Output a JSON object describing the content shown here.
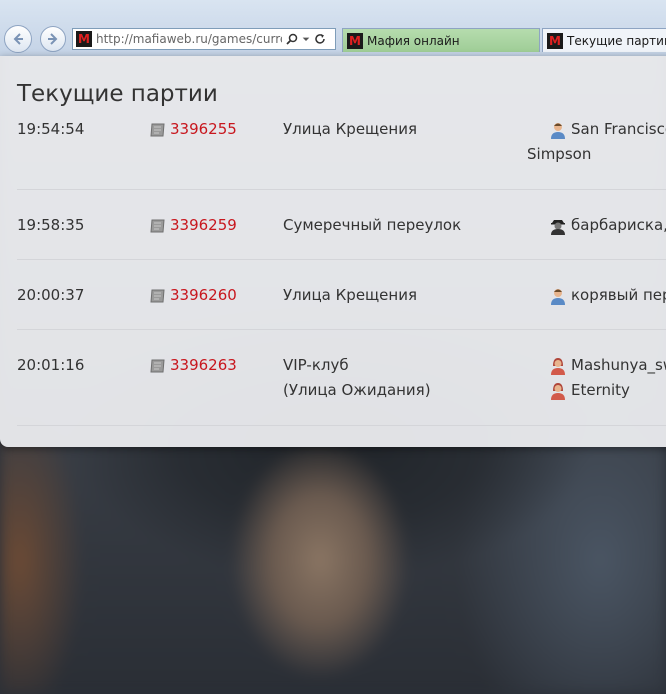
{
  "browser": {
    "address_url": "http://mafiaweb.ru/games/current/",
    "tabs": [
      {
        "title": "Мафия онлайн"
      },
      {
        "title": "Текущие партии ::"
      }
    ]
  },
  "page": {
    "title": "Текущие партии"
  },
  "games": [
    {
      "time": "19:54:54",
      "game_id": "3396255",
      "location": [
        "Улица Крещения"
      ],
      "players": [
        {
          "name": "San Francisco",
          "icon": "male-user-icon"
        },
        {
          "name": "Simpson",
          "icon": ""
        }
      ]
    },
    {
      "time": "19:58:35",
      "game_id": "3396259",
      "location": [
        "Сумеречный переулок"
      ],
      "players": [
        {
          "name": "барбариска,",
          "icon": "spy-user-icon"
        }
      ]
    },
    {
      "time": "20:00:37",
      "game_id": "3396260",
      "location": [
        "Улица Крещения"
      ],
      "players": [
        {
          "name": "корявый пер",
          "icon": "male-user-icon"
        }
      ]
    },
    {
      "time": "20:01:16",
      "game_id": "3396263",
      "location": [
        "VIP-клуб",
        "(Улица Ожидания)"
      ],
      "players": [
        {
          "name": "Mashunya_sw",
          "icon": "female-user-icon"
        },
        {
          "name": "Eternity",
          "icon": "female-user-icon"
        }
      ]
    }
  ],
  "colors": {
    "link": "#c8171e",
    "text": "#333333",
    "panel": "#e9eaed"
  }
}
